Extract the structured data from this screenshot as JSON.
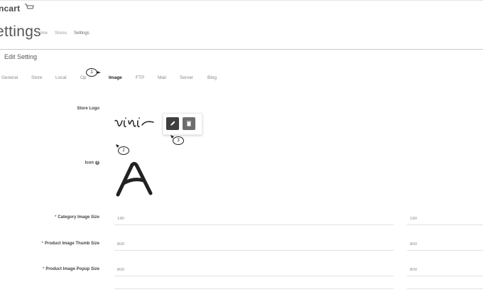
{
  "brand": {
    "name": "ncart",
    "cart_icon": "shopping-cart-icon"
  },
  "header": {
    "title": "ettings",
    "breadcrumbs": [
      "Home",
      "Stores",
      "Settings"
    ]
  },
  "panel": {
    "heading": "Edit Setting"
  },
  "tabs": [
    "General",
    "Store",
    "Local",
    "Op",
    "Image",
    "FTP",
    "Mail",
    "Server",
    "Blog"
  ],
  "active_tab": "Image",
  "callouts": [
    "1",
    "2",
    "3"
  ],
  "fields": {
    "store_logo": {
      "label": "Store Logo",
      "image_text": "vini"
    },
    "icon": {
      "label": "Icon",
      "help_icon": "question-circle-icon"
    },
    "category_image_size": {
      "label": "Category Image Size",
      "width": "190",
      "height": "190"
    },
    "product_thumb_size": {
      "label": "Product Image Thumb Size",
      "width": "800",
      "height": "800"
    },
    "product_popup_size": {
      "label": "Product Image Popup Size",
      "width": "800",
      "height": "800"
    }
  },
  "popover": {
    "edit_icon": "pencil-icon",
    "delete_icon": "trash-icon"
  },
  "colors": {
    "edit_button": "#3e3e3e",
    "delete_button": "#6d6d6d"
  }
}
